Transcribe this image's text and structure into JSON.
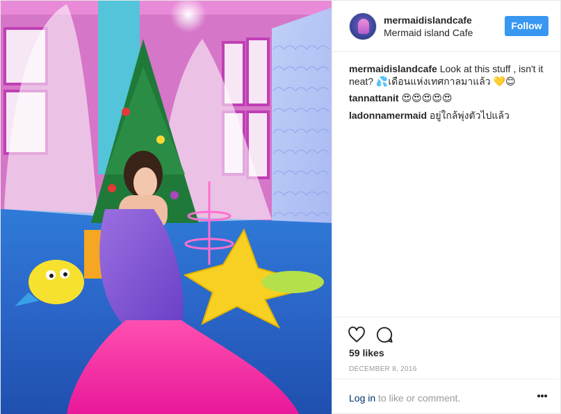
{
  "photo": {
    "alt": "Girl in mermaid costume sitting beside a Christmas tree with plush starfish and fish toys"
  },
  "header": {
    "username": "mermaidislandcafe",
    "location": "Mermaid island Cafe",
    "follow_label": "Follow"
  },
  "comments": [
    {
      "user": "mermaidislandcafe",
      "text": "Look at this stuff , isn't it neat? 💦เดือนแห่งเทศกาลมาแล้ว 💛😊"
    },
    {
      "user": "tannattanit",
      "text": "😍😍😍😍😍"
    },
    {
      "user": "ladonnamermaid",
      "text": "อยู่ใกล้พุ่งตัวไปแล้ว"
    }
  ],
  "actions": {
    "like_icon": "heart-icon",
    "comment_icon": "comment-icon",
    "likes_text": "59 likes",
    "date": "DECEMBER 8, 2016"
  },
  "footer": {
    "login_label": "Log in",
    "login_suffix": " to like or comment.",
    "more_icon": "more-options-icon"
  },
  "colors": {
    "follow_bg": "#3897f0",
    "link": "#003569",
    "muted": "#999999",
    "border": "#efefef"
  }
}
